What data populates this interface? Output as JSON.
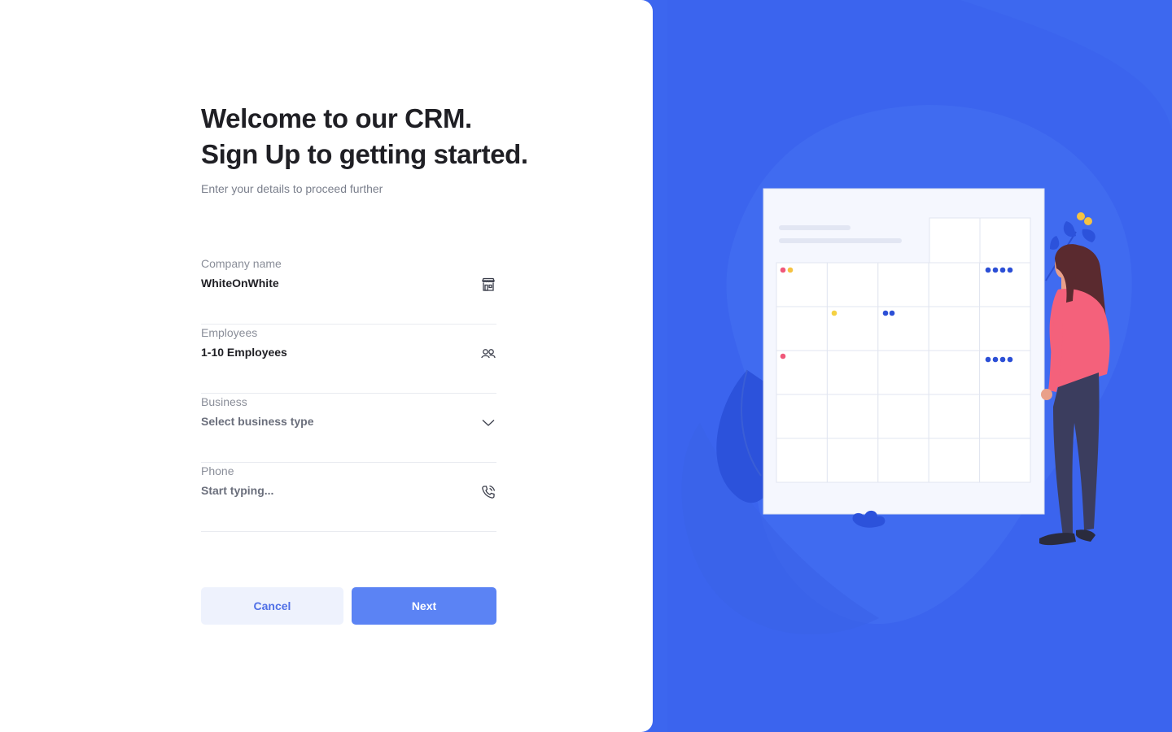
{
  "header": {
    "title_line1": "Welcome to our CRM.",
    "title_line2": "Sign Up to getting started.",
    "subtitle": "Enter your details to proceed further"
  },
  "form": {
    "company": {
      "label": "Company name",
      "value": "WhiteOnWhite",
      "icon": "storefront-icon"
    },
    "employees": {
      "label": "Employees",
      "value": "1-10 Employees",
      "icon": "users-icon"
    },
    "business": {
      "label": "Business",
      "value": "Select business type",
      "icon": "chevron-down-icon"
    },
    "phone": {
      "label": "Phone",
      "placeholder": "Start typing...",
      "icon": "phone-icon"
    }
  },
  "actions": {
    "cancel_label": "Cancel",
    "next_label": "Next"
  },
  "colors": {
    "brand_blue": "#3c66ef",
    "button_primary": "#5b83f4",
    "button_secondary_bg": "#eef2fd",
    "title_text": "#1f1f24"
  }
}
